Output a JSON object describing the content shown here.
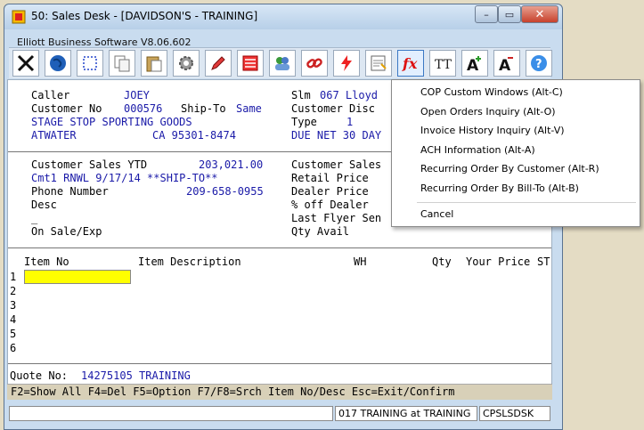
{
  "window": {
    "title": "50: Sales Desk - [DAVIDSON'S - TRAINING]",
    "subtitle": "Elliott Business Software V8.06.602",
    "min_label": "–",
    "max_label": "▭",
    "close_label": "✕"
  },
  "toolbar": {
    "icons": [
      "scissors-icon",
      "globe-icon",
      "select-icon",
      "copy-icon",
      "paste-icon",
      "gear-icon",
      "edit-icon",
      "list-icon",
      "users-icon",
      "link-icon",
      "flash-icon",
      "notes-icon",
      "function-icon",
      "font-icon",
      "font-larger-icon",
      "font-smaller-icon",
      "help-icon"
    ]
  },
  "header": {
    "caller_label": "Caller",
    "caller_value": "JOEY",
    "slm_label": "Slm",
    "slm_value": "067 Lloyd",
    "customer_no_label": "Customer No",
    "customer_no_value": "000576",
    "ship_to_label": "Ship-To",
    "ship_to_value": "Same",
    "customer_disc_label": "Customer Disc",
    "customer_name": "STAGE STOP SPORTING GOODS",
    "type_label": "Type",
    "type_value": "1",
    "city": "ATWATER",
    "state_zip": "CA 95301-8474",
    "terms": "DUE NET 30 DAY"
  },
  "info": {
    "sales_ytd_label": "Customer Sales YTD",
    "sales_ytd_value": "203,021.00",
    "customer_sales_label": "Customer Sales",
    "cmt1": "Cmt1 RNWL 9/17/14 **SHIP-TO**",
    "retail_price_label": "Retail Price",
    "phone_label": "Phone Number",
    "phone_value": "209-658-0955",
    "dealer_price_label": "Dealer Price",
    "desc_label": "Desc",
    "pct_off_dealer_label": "% off Dealer",
    "last_flyer_label": "Last Flyer Sen",
    "on_sale_label": "On Sale/Exp",
    "qty_avail_label": "Qty Avail",
    "underscore": "_"
  },
  "grid": {
    "headers": {
      "item_no": "Item No",
      "desc": "Item Description",
      "wh": "WH",
      "qty": "Qty",
      "price": "Your Price",
      "st": "ST"
    },
    "row_numbers": [
      "1",
      "2",
      "3",
      "4",
      "5",
      "6"
    ]
  },
  "quote": {
    "label": "Quote No:",
    "value": "14275105 TRAINING"
  },
  "fkeys": "F2=Show All F4=Del F5=Option F7/F8=Srch Item No/Desc Esc=Exit/Confirm",
  "status": {
    "left": "",
    "user": "017 TRAINING at TRAINING",
    "program": "CPSLSDSK"
  },
  "context_menu": {
    "items": [
      "COP Custom Windows  (Alt-C)",
      "Open Orders Inquiry  (Alt-O)",
      "Invoice History Inquiry  (Alt-V)",
      "ACH Information  (Alt-A)",
      "Recurring Order By Customer  (Alt-R)",
      "Recurring Order By Bill-To  (Alt-B)"
    ],
    "cancel": "Cancel"
  }
}
